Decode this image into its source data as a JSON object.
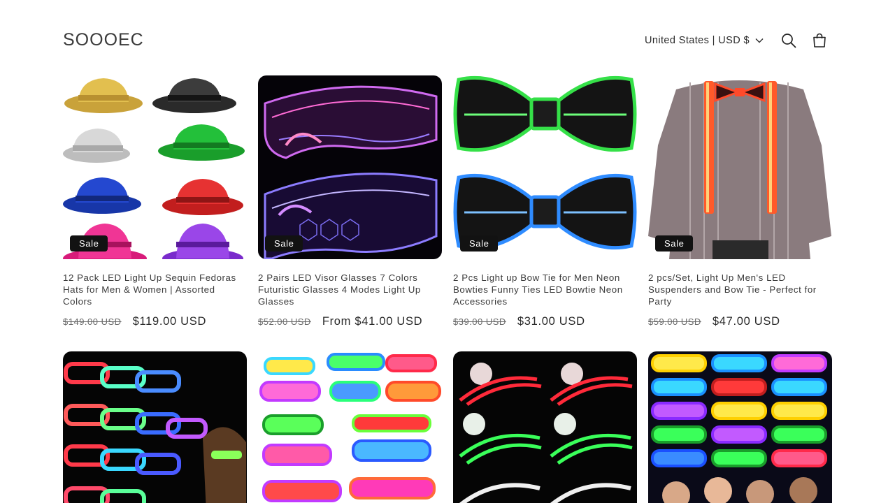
{
  "header": {
    "logo": "SOOOEC",
    "locale": "United States | USD $",
    "search_icon": "search-icon",
    "cart_icon": "cart-icon"
  },
  "products": [
    {
      "title": "12 Pack LED Light Up Sequin Fedoras Hats for Men & Women | Assorted Colors",
      "badge": "Sale",
      "old_price": "$149.00 USD",
      "price": "$119.00 USD"
    },
    {
      "title": "2 Pairs LED Visor Glasses 7 Colors Futuristic Glasses 4 Modes Light Up Glasses",
      "badge": "Sale",
      "old_price": "$52.00 USD",
      "price": "From $41.00 USD"
    },
    {
      "title": "2 Pcs Light up Bow Tie for Men Neon Bowties Funny Ties LED Bowtie Neon Accessories",
      "badge": "Sale",
      "old_price": "$39.00 USD",
      "price": "$31.00 USD"
    },
    {
      "title": "2 pcs/Set, Light Up Men's LED Suspenders and Bow Tie - Perfect for Party",
      "badge": "Sale",
      "old_price": "$59.00 USD",
      "price": "$47.00 USD"
    }
  ],
  "colors": {
    "badge_bg": "#121212",
    "text": "#3a3a3a"
  }
}
